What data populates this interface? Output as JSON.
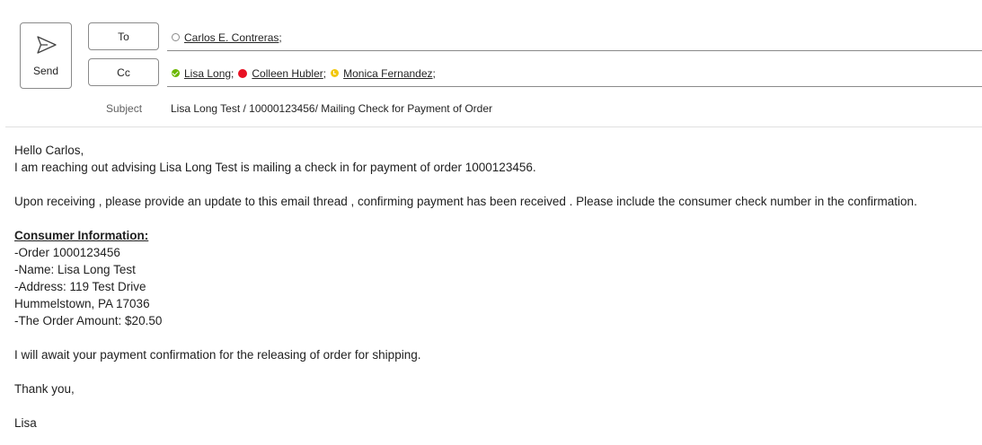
{
  "compose": {
    "send_label": "Send",
    "to_label": "To",
    "cc_label": "Cc",
    "subject_label": "Subject",
    "subject": "Lisa Long Test / 10000123456/ Mailing Check for Payment of Order",
    "to": [
      {
        "name": "Carlos E. Contreras",
        "sep": ";",
        "presence": "offline",
        "presence_icon": "presence-offline-icon"
      }
    ],
    "cc": [
      {
        "name": "Lisa Long",
        "sep": ";",
        "presence": "available",
        "presence_icon": "presence-available-icon"
      },
      {
        "name": "Colleen Hubler",
        "sep": ";",
        "presence": "busy",
        "presence_icon": "presence-busy-icon"
      },
      {
        "name": "Monica Fernandez",
        "sep": ";",
        "presence": "away",
        "presence_icon": "presence-away-icon"
      }
    ]
  },
  "body": {
    "greeting": "Hello Carlos,",
    "line1": "I am reaching out advising Lisa Long Test is mailing a check in for payment of order 1000123456.",
    "line2": "Upon receiving ,  please provide an update to this email thread , confirming payment has been received . Please include the consumer check number in the confirmation.",
    "heading": "Consumer Information:",
    "info": [
      "-Order 1000123456",
      "-Name: Lisa Long Test",
      "-Address: 119 Test Drive",
      "Hummelstown, PA 17036",
      "-The Order Amount: $20.50"
    ],
    "line3": "I will await your payment confirmation for the releasing of order for shipping.",
    "closing": "Thank you,",
    "signature": "Lisa"
  },
  "colors": {
    "available": "#6bb700",
    "busy": "#e81123",
    "away": "#f2c80f",
    "border": "#8a8a8a"
  }
}
